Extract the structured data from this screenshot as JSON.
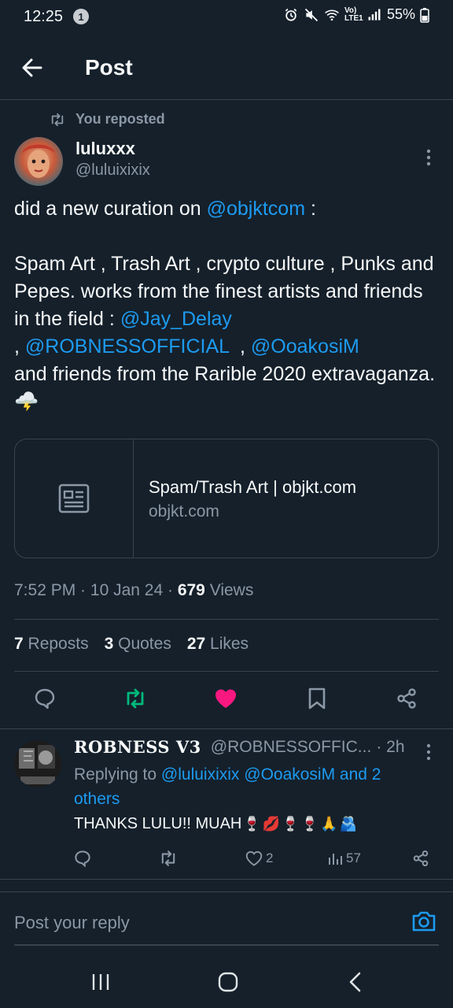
{
  "status_bar": {
    "time": "12:25",
    "notification_count": "1",
    "network": "Vo) LTE1",
    "battery": "55%"
  },
  "header": {
    "title": "Post"
  },
  "repost": {
    "label": "You reposted"
  },
  "author": {
    "name": "luluxxx",
    "handle": "@luluixixix"
  },
  "post": {
    "segments": [
      {
        "text": "did a new curation on "
      },
      {
        "text": "@objktcom",
        "link": true
      },
      {
        "text": " :\n\nSpam Art , Trash Art , crypto culture , Punks and Pepes. works from the finest artists and friends in the field : "
      },
      {
        "text": "@Jay_Delay",
        "link": true
      },
      {
        "text": "\n, "
      },
      {
        "text": "@ROBNESSOFFICIAL",
        "link": true
      },
      {
        "text": "  , "
      },
      {
        "text": "@OoakosiM",
        "link": true
      },
      {
        "text": "\nand friends from the Rarible 2020 extravaganza.🌩️"
      }
    ]
  },
  "link_card": {
    "title": "Spam/Trash Art | objkt.com",
    "domain": "objkt.com"
  },
  "meta": {
    "time": "7:52 PM",
    "date": "10 Jan 24",
    "views_count": "679",
    "views_label": "Views"
  },
  "counts": {
    "reposts_num": "7",
    "reposts_label": "Reposts",
    "quotes_num": "3",
    "quotes_label": "Quotes",
    "likes_num": "27",
    "likes_label": "Likes"
  },
  "actions": {
    "icons": [
      "reply-icon",
      "repost-icon",
      "like-icon",
      "bookmark-icon",
      "share-icon"
    ],
    "repost_color": "#00ba7c",
    "like_color": "#f91880"
  },
  "reply": {
    "name": "ROBNESS V3",
    "handle": "@ROBNESSOFFIC...",
    "time": "· 2h",
    "replying_prefix": "Replying to ",
    "replying_users": "@luluixixix @OoakosiM and 2 others",
    "text": "THANKS LULU!! MUAH",
    "emojis": [
      "🍷",
      "💋",
      "🍷",
      "🍷",
      "🙏",
      "🫂"
    ],
    "likes": "2",
    "views": "57"
  },
  "compose": {
    "placeholder": "Post your reply"
  },
  "colors": {
    "background": "#15202b",
    "accent": "#1d9bf0",
    "muted": "#8b98a5",
    "border": "#38444d"
  }
}
